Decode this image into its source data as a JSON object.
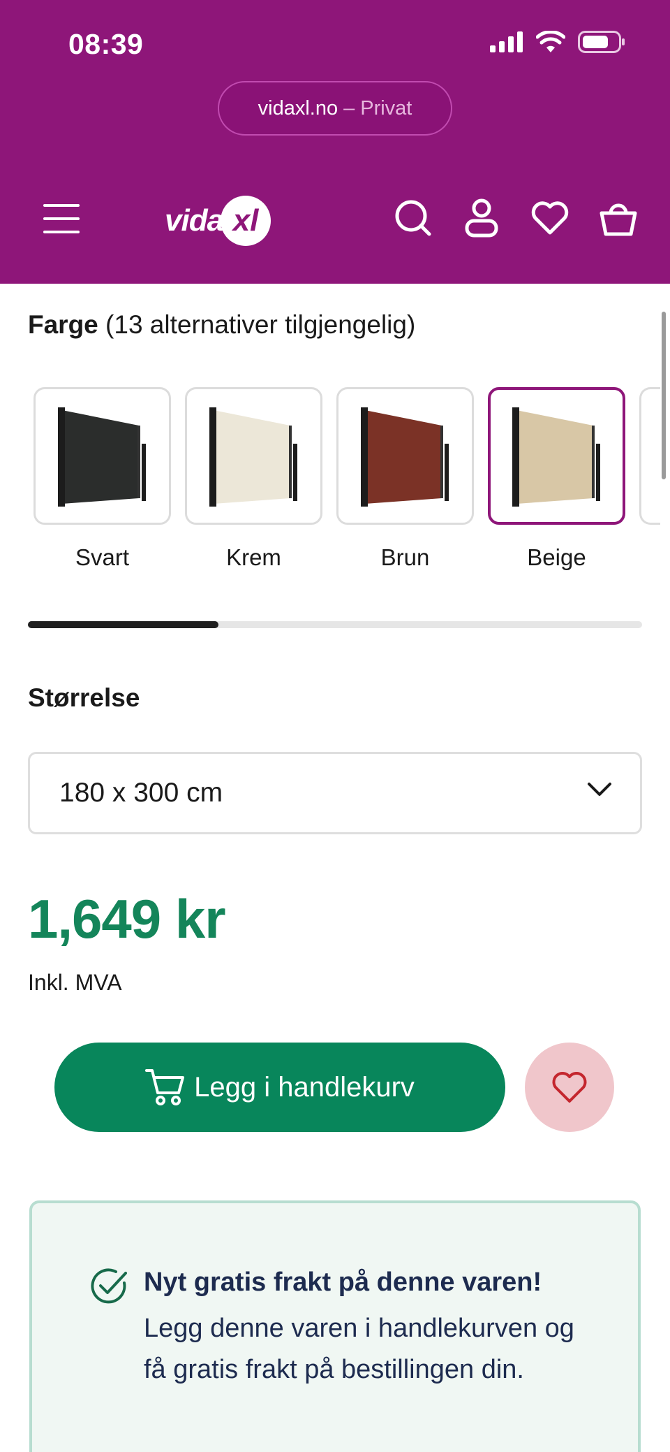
{
  "status_bar": {
    "time": "08:39"
  },
  "browser": {
    "url": "vidaxl.no",
    "separator": "–",
    "mode": "Privat"
  },
  "header": {
    "brand_text": "vida",
    "brand_badge": "xl",
    "icons": [
      "menu-icon",
      "search-icon",
      "account-icon",
      "wishlist-icon",
      "basket-icon"
    ]
  },
  "color_section": {
    "label": "Farge",
    "count_text": "(13 alternativer tilgjengelig)",
    "options": [
      {
        "label": "Svart",
        "fabric": "#2b2d2c",
        "selected": false
      },
      {
        "label": "Krem",
        "fabric": "#ece7d8",
        "selected": false
      },
      {
        "label": "Brun",
        "fabric": "#7b3226",
        "selected": false
      },
      {
        "label": "Beige",
        "fabric": "#d8c7a6",
        "selected": true
      }
    ],
    "carousel_progress": 0.31
  },
  "size_section": {
    "label": "Størrelse",
    "selected": "180 x 300 cm"
  },
  "price": {
    "amount": "1,649 kr",
    "vat_note": "Inkl. MVA"
  },
  "actions": {
    "add_to_cart": "Legg i handlekurv"
  },
  "shipping_notice": {
    "title": "Nyt gratis frakt på denne varen!",
    "text": "Legg denne varen i handlekurven og få gratis frakt på bestillingen din."
  },
  "colors": {
    "brand_purple": "#8e1679",
    "price_green": "#14855a",
    "button_green": "#08865b",
    "wishlist_pink": "#f0c6cb",
    "notice_bg": "#f0f7f3",
    "notice_border": "#b7ddd0"
  }
}
